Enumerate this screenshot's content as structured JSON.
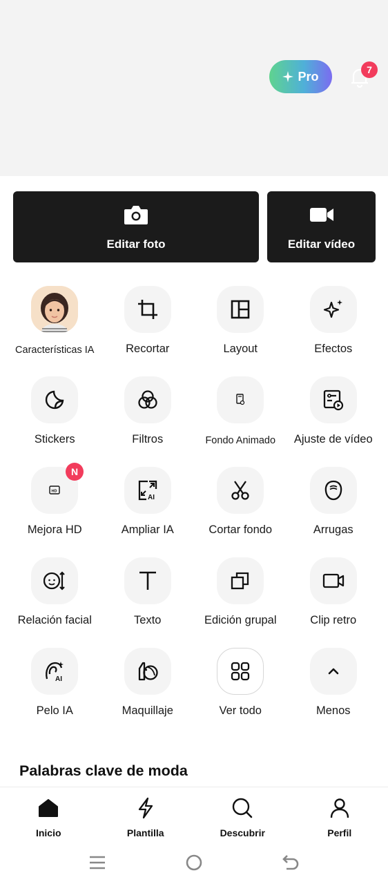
{
  "header": {
    "pro_label": "Pro",
    "notification_count": "7"
  },
  "edit_buttons": {
    "photo_label": "Editar foto",
    "video_label": "Editar vídeo"
  },
  "tools": [
    {
      "label": "Características IA",
      "icon": "ai-features-avatar"
    },
    {
      "label": "Recortar",
      "icon": "crop-icon"
    },
    {
      "label": "Layout",
      "icon": "layout-icon"
    },
    {
      "label": "Efectos",
      "icon": "sparkles-icon"
    },
    {
      "label": "Stickers",
      "icon": "sticker-icon"
    },
    {
      "label": "Filtros",
      "icon": "filters-icon"
    },
    {
      "label": "Fondo Animado",
      "icon": "animated-background-icon"
    },
    {
      "label": "Ajuste de vídeo",
      "icon": "video-adjust-icon"
    },
    {
      "label": "Mejora HD",
      "icon": "hd-enhance-icon",
      "badge": "N"
    },
    {
      "label": "Ampliar IA",
      "icon": "ai-expand-icon"
    },
    {
      "label": "Cortar fondo",
      "icon": "scissors-icon"
    },
    {
      "label": "Arrugas",
      "icon": "wrinkles-face-icon"
    },
    {
      "label": "Relación facial",
      "icon": "face-ratio-icon"
    },
    {
      "label": "Texto",
      "icon": "text-icon"
    },
    {
      "label": "Edición grupal",
      "icon": "batch-edit-icon"
    },
    {
      "label": "Clip retro",
      "icon": "retro-clip-icon"
    },
    {
      "label": "Pelo IA",
      "icon": "ai-hair-icon"
    },
    {
      "label": "Maquillaje",
      "icon": "makeup-icon"
    },
    {
      "label": "Ver todo",
      "icon": "grid-icon"
    },
    {
      "label": "Menos",
      "icon": "chevron-up-icon"
    }
  ],
  "trending": {
    "title": "Palabras clave de moda"
  },
  "bottom_nav": [
    {
      "label": "Inicio",
      "icon": "home-icon"
    },
    {
      "label": "Plantilla",
      "icon": "lightning-icon"
    },
    {
      "label": "Descubrir",
      "icon": "search-icon"
    },
    {
      "label": "Perfil",
      "icon": "profile-icon"
    }
  ],
  "colors": {
    "accent_badge": "#f23c5c",
    "dark_button": "#1b1b1b",
    "pro_gradient": [
      "#5fd38f",
      "#4fb0d8",
      "#7b6cf0"
    ]
  }
}
